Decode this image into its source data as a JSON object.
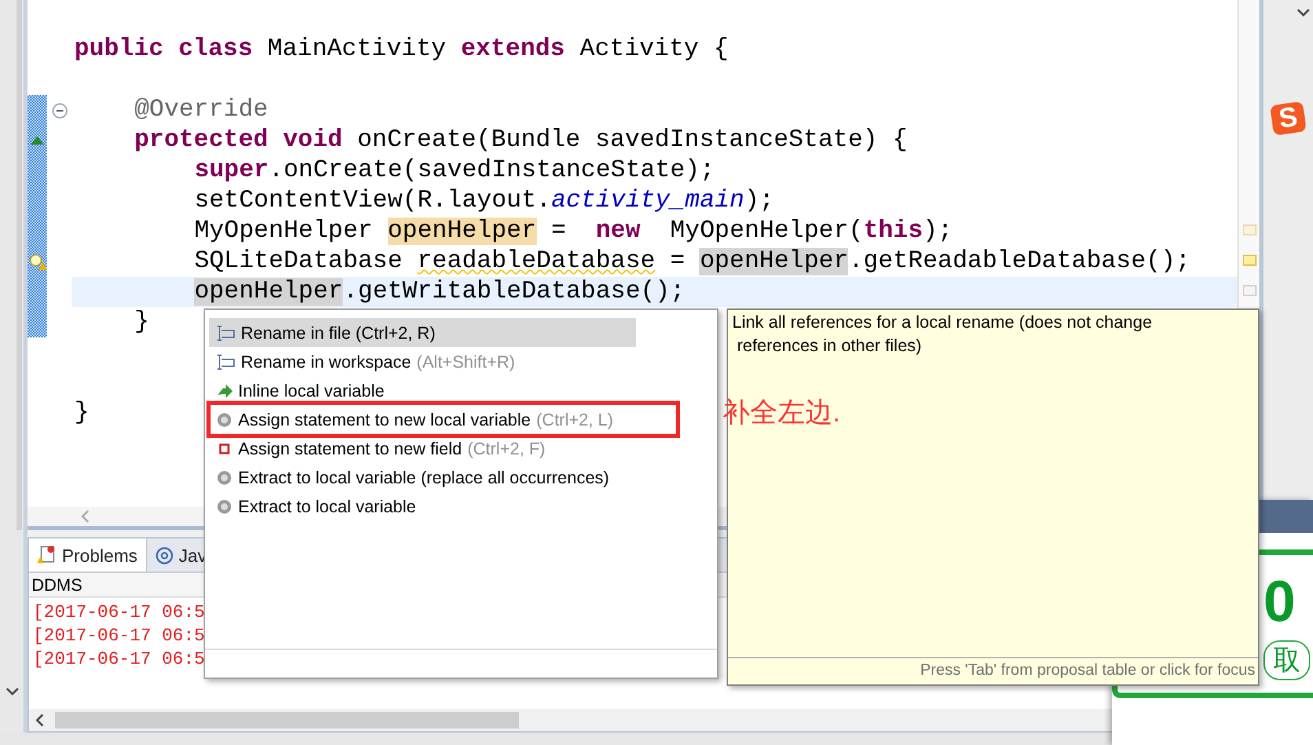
{
  "editor": {
    "lines": [
      {
        "changed": false,
        "current": false,
        "segments": [
          {
            "kind": "keyword",
            "text": "public class"
          },
          {
            "kind": "plain",
            "text": " MainActivity "
          },
          {
            "kind": "keyword",
            "text": "extends"
          },
          {
            "kind": "plain",
            "text": " Activity {"
          }
        ],
        "children": [
          {
            "changed": false,
            "current": false
          },
          {
            "kind": "fold",
            "changed": true,
            "current": false,
            "segments": [
              {
                "kind": "annotation",
                "text": "@Override"
              }
            ]
          },
          {
            "kind": "override",
            "changed": true,
            "current": false,
            "segments": [
              {
                "kind": "keyword",
                "text": "protected void"
              },
              {
                "kind": "plain",
                "text": " onCreate(Bundle savedInstanceState) {"
              }
            ],
            "children": [
              {
                "changed": true,
                "current": false,
                "segments": [
                  {
                    "kind": "keyword",
                    "text": "super"
                  },
                  {
                    "kind": "plain",
                    "text": ".onCreate(savedInstanceState);"
                  }
                ]
              },
              {
                "changed": true,
                "current": false,
                "segments": [
                  {
                    "kind": "plain",
                    "text": "setContentView(R.layout."
                  },
                  {
                    "kind": "field",
                    "text": "activity_main"
                  },
                  {
                    "kind": "plain",
                    "text": ");"
                  }
                ]
              },
              {
                "changed": true,
                "current": false,
                "segments": [
                  {
                    "kind": "plain",
                    "text": "MyOpenHelper "
                  },
                  {
                    "kind": "write",
                    "text": "openHelper"
                  },
                  {
                    "kind": "plain",
                    "text": " =  "
                  },
                  {
                    "kind": "keyword",
                    "text": "new"
                  },
                  {
                    "kind": "plain",
                    "text": "  MyOpenHelper("
                  },
                  {
                    "kind": "keyword",
                    "text": "this"
                  },
                  {
                    "kind": "plain",
                    "text": ");"
                  }
                ]
              },
              {
                "kind": "warning",
                "changed": true,
                "current": false,
                "segments": [
                  {
                    "kind": "plain",
                    "text": "SQLiteDatabase "
                  },
                  {
                    "kind": "warn",
                    "text": "readableDatabase"
                  },
                  {
                    "kind": "plain",
                    "text": " = "
                  },
                  {
                    "kind": "read",
                    "text": "openHelper"
                  },
                  {
                    "kind": "plain",
                    "text": ".getReadableDatabase();"
                  }
                ]
              },
              {
                "changed": true,
                "current": true,
                "segments": [
                  {
                    "kind": "read",
                    "text": "openHelper"
                  },
                  {
                    "kind": "plain",
                    "text": ".getWritableDatabase();"
                  }
                ]
              }
            ]
          },
          {
            "changed": true,
            "current": false,
            "segments": [
              {
                "kind": "plain",
                "text": "}"
              }
            ]
          },
          {
            "changed": false,
            "current": false
          },
          {
            "changed": false,
            "current": false
          }
        ]
      },
      {
        "changed": false,
        "current": false,
        "segments": [
          {
            "kind": "plain",
            "text": "}"
          }
        ]
      }
    ],
    "ruler_marks": [
      {
        "kind": "occurrence"
      },
      {
        "kind": "warning"
      },
      {
        "kind": "occurrence-plain"
      }
    ]
  },
  "ime_logo_letter": "S",
  "bottom_panel": {
    "tabs": [
      {
        "kind": "problems",
        "label": "Problems",
        "selected": true
      },
      {
        "kind": "javadoc",
        "label": "Jav",
        "selected": false
      }
    ],
    "title": "DDMS",
    "log_lines": [
      "[2017-06-17 06:5",
      "[2017-06-17 06:5",
      "[2017-06-17 06:5"
    ]
  },
  "proposals": {
    "items": [
      {
        "kind": "rename",
        "label": "Rename in file (Ctrl+2, R)",
        "selected": true,
        "annotated": false
      },
      {
        "kind": "rename",
        "label": "Rename in workspace",
        "shortcut": "(Alt+Shift+R)",
        "selected": false,
        "annotated": false
      },
      {
        "kind": "inline",
        "label": "Inline local variable",
        "selected": false,
        "annotated": false
      },
      {
        "kind": "local",
        "label": "Assign statement to new local variable",
        "shortcut": "(Ctrl+2, L)",
        "selected": false,
        "annotated": true
      },
      {
        "kind": "field",
        "label": "Assign statement to new field",
        "shortcut": "(Ctrl+2, F)",
        "selected": false,
        "annotated": false
      },
      {
        "kind": "local",
        "label": "Extract to local variable (replace all occurrences)",
        "selected": false,
        "annotated": false
      },
      {
        "kind": "local",
        "label": "Extract to local variable",
        "selected": false,
        "annotated": false
      }
    ]
  },
  "info": {
    "text": "Link all references for a local rename (does not change\n references in other files)",
    "footer": "Press 'Tab' from proposal table or click for focus"
  },
  "note": "补全左边.",
  "background_popup": {
    "big_number": "0",
    "button": "取"
  }
}
